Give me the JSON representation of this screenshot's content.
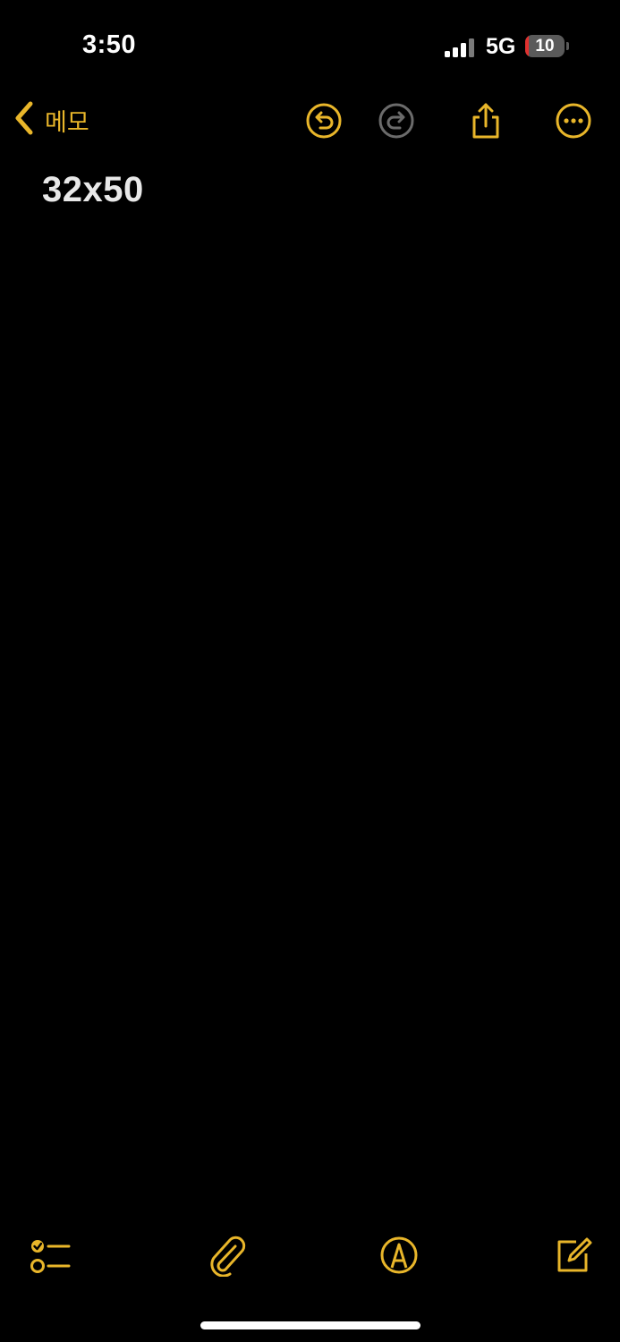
{
  "status_bar": {
    "time": "3:50",
    "network": "5G",
    "battery_level": "10",
    "battery_fraction": 0.1,
    "battery_color": "#e0302e"
  },
  "nav": {
    "back_label": "메모",
    "icons": [
      "chevron-left-icon",
      "undo-icon",
      "redo-icon",
      "share-icon",
      "more-icon"
    ]
  },
  "note": {
    "title": "32x50"
  },
  "toolbar": {
    "icons": [
      "checklist-icon",
      "paperclip-icon",
      "markup-icon",
      "compose-icon"
    ]
  },
  "colors": {
    "accent": "#e9b62a",
    "disabled": "#6b6b6b",
    "background": "#000000",
    "text": "#e8e8e8"
  }
}
